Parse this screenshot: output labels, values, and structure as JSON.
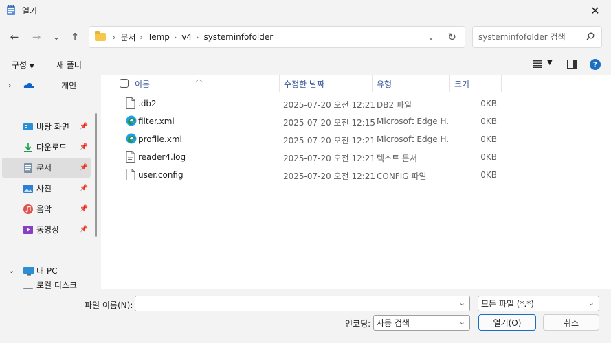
{
  "window": {
    "title": "열기",
    "close_label": "✕"
  },
  "nav": {
    "back": "←",
    "forward": "→",
    "recent": "⌄",
    "up": "↑",
    "breadcrumb": [
      "문서",
      "Temp",
      "v4",
      "systeminfofolder"
    ],
    "search_placeholder": "systeminfofolder 검색"
  },
  "toolbar": {
    "organize": "구성",
    "new_folder": "새 폴더",
    "help": "?"
  },
  "sidebar": {
    "onedrive": "- 개인",
    "quick": [
      {
        "label": "바탕 화면",
        "icon": "desktop-icon"
      },
      {
        "label": "다운로드",
        "icon": "download-icon"
      },
      {
        "label": "문서",
        "icon": "documents-icon"
      },
      {
        "label": "사진",
        "icon": "pictures-icon"
      },
      {
        "label": "음악",
        "icon": "music-icon"
      },
      {
        "label": "동영상",
        "icon": "videos-icon"
      }
    ],
    "this_pc": "내 PC",
    "partial": "로컬 디스크 (C:)"
  },
  "columns": {
    "name": "이름",
    "date": "수정한 날짜",
    "type": "유형",
    "size": "크기"
  },
  "files": [
    {
      "name": ".db2",
      "date": "2025-07-20 오전 12:21",
      "type": "DB2 파일",
      "size": "0KB",
      "icon": "file-icon"
    },
    {
      "name": "filter.xml",
      "date": "2025-07-20 오전 12:15",
      "type": "Microsoft Edge H...",
      "size": "0KB",
      "icon": "edge-icon"
    },
    {
      "name": "profile.xml",
      "date": "2025-07-20 오전 12:21",
      "type": "Microsoft Edge H...",
      "size": "0KB",
      "icon": "edge-icon"
    },
    {
      "name": "reader4.log",
      "date": "2025-07-20 오전 12:21",
      "type": "텍스트 문서",
      "size": "0KB",
      "icon": "text-file-icon"
    },
    {
      "name": "user.config",
      "date": "2025-07-20 오전 12:21",
      "type": "CONFIG 파일",
      "size": "0KB",
      "icon": "file-icon"
    }
  ],
  "bottom": {
    "filename_label": "파일 이름(N):",
    "filename_value": "",
    "filter_value": "모든 파일  (*.*)",
    "encoding_label": "인코딩:",
    "encoding_value": "자동 검색",
    "open_label": "열기(O)",
    "cancel_label": "취소"
  },
  "colors": {
    "accent": "#1b6ec2",
    "selection": "#dedede",
    "header_text": "#3a5a9a"
  }
}
